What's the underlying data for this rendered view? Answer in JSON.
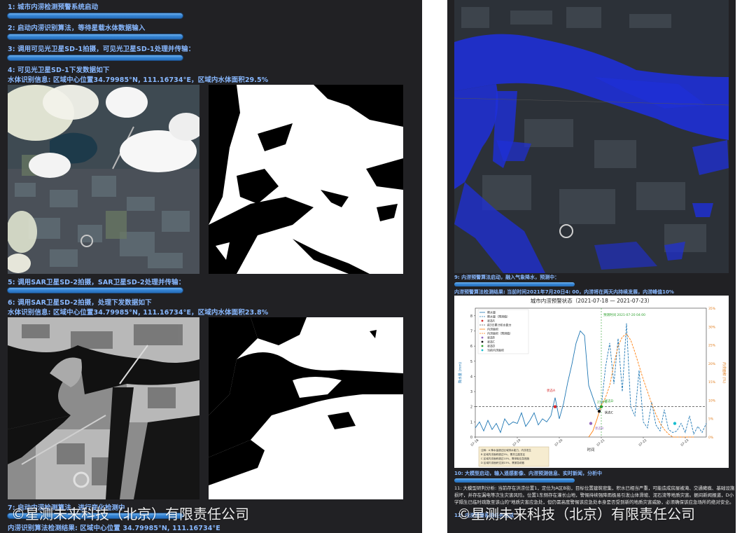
{
  "left": {
    "lines": [
      "1: 城市内涝检测预警系统启动",
      "2: 启动内涝识别算法，等待星载水体数据输入",
      "3: 调用可见光卫星SD-1拍摄，可见光卫星SD-1处理并传输：",
      "4: 可见光卫星SD-1下发数据如下",
      "水体识别信息: 区域中心位置34.79985°N, 111.16734°E，区域内水体面积29.5%",
      "5: 调用SAR卫星SD-2拍摄，SAR卫星SD-2处理并传输：",
      "6: 调用SAR卫星SD-2拍摄，处理下发数据如下",
      "水体识别信息: 区域中心位置34.79985°N, 111.16734°E，区域内水体面积23.8%",
      "7: 启动内涝检测算法，进行变化检测中",
      "内涝识别算法检测结果: 区域中心位置 34.79985°N, 111.16734°E"
    ]
  },
  "right": {
    "lines": [
      "9: 内涝预警算法启动，融入气象降水，预测中：",
      "内涝预警算法检测结果: 当前时间2021年7月20日4: 00，内涝将在两天内持续发展，内涝峰值10%",
      "10: 大模型启动，输入遥感影像、内涝预测信息、实时新闻，分析中",
      "11: 大模型研判分析: 当前存在洪涝位置1，定位为A区B街，目标位置建筑密集，积水已相当严重，可能造成房屋被淹、交通瘫痪、基础设施",
      "损坏，并存在漏电等次生灾害风险。位置1东侧存在灌长山地，警惕持续强降雨极易引发山体滑坡、泥石流等地质灾害。据间新闻报道，D小",
      "学隔生已临时疏散至该山的\"地质灾害应急处，但仍需高度警惕该应急处本身是否受到新的地质灾害威胁，必须确保该应急场所的绝对安全。",
      "12: 内涝预警系统任务完成"
    ]
  },
  "watermark": "©星测未来科技（北京）有限责任公司",
  "chart_data": {
    "type": "line",
    "title": "城市内涝预警状态（2021-07-18 — 2021-07-23）",
    "xlabel": "时间",
    "ylabel": "降水量 (mm)",
    "y2label": "内涝面积 (%)",
    "x_ticks": [
      "07-18",
      "07-19",
      "07-20",
      "07-21",
      "07-22",
      "07-23"
    ],
    "y_ticks": [
      0,
      1,
      2,
      3,
      4,
      5,
      6,
      7,
      8
    ],
    "y2_ticks": [
      "0%",
      "5%",
      "10%",
      "15%",
      "20%",
      "25%",
      "30%",
      "35%"
    ],
    "ylim": [
      0,
      8.5
    ],
    "xlim": [
      0,
      5.5
    ],
    "threshold": 2,
    "legend": [
      "降水量",
      "降水量（预测值）",
      "状态A",
      "前3日累计积水能力",
      "内涝面积",
      "内涝面积（预测值）",
      "状态B",
      "状态C",
      "状态D",
      "当前内涝面积"
    ],
    "series": [
      {
        "name": "降水量",
        "color": "#1f77b4",
        "style": "solid",
        "x": [
          0,
          0.1,
          0.2,
          0.3,
          0.4,
          0.5,
          0.6,
          0.7,
          0.8,
          0.9,
          1.0,
          1.1,
          1.2,
          1.3,
          1.4,
          1.5,
          1.6,
          1.7,
          1.8,
          1.9,
          2.0,
          2.1,
          2.2,
          2.3,
          2.4,
          2.5,
          2.6,
          2.7,
          2.8,
          2.9,
          3.0
        ],
        "values": [
          0.6,
          1.0,
          0.4,
          1.1,
          0.5,
          0.9,
          0.3,
          1.2,
          0.8,
          1.0,
          0.9,
          1.6,
          0.7,
          1.1,
          1.6,
          0.8,
          1.2,
          1.0,
          1.4,
          2.6,
          1.2,
          2.2,
          3.6,
          4.8,
          6.2,
          7.0,
          6.7,
          3.4,
          2.6,
          1.8,
          2.0
        ]
      },
      {
        "name": "降水量（预测值）",
        "color": "#1f77b4",
        "style": "dashed",
        "x": [
          3.0,
          3.1,
          3.2,
          3.3,
          3.4,
          3.5,
          3.6,
          3.7,
          3.8,
          3.9,
          4.0,
          4.1,
          4.2,
          4.3,
          4.4,
          4.5,
          4.6,
          4.7,
          4.8,
          4.9,
          5.0,
          5.1,
          5.2,
          5.3,
          5.4,
          5.5
        ],
        "values": [
          2.0,
          4.6,
          6.2,
          3.5,
          6.5,
          3.0,
          7.5,
          2.0,
          1.4,
          4.4,
          1.0,
          0.6,
          2.3,
          0.8,
          0.4,
          1.8,
          0.5,
          0.3,
          0.4,
          0.9,
          0.3,
          1.4,
          0.2,
          0.7,
          0.3,
          0.9
        ]
      },
      {
        "name": "内涝面积",
        "color": "#ff7f0e",
        "style": "solid",
        "x": [
          2.7,
          2.8,
          2.9,
          3.0
        ],
        "values": [
          0,
          0.4,
          1.2,
          2.1
        ]
      },
      {
        "name": "内涝面积（预测值）",
        "color": "#ff7f0e",
        "style": "dashed",
        "x": [
          3.0,
          3.1,
          3.2,
          3.3,
          3.4,
          3.5,
          3.6,
          3.7,
          3.8,
          3.9,
          4.0,
          4.1,
          4.2,
          4.3,
          4.4,
          4.5,
          4.6,
          4.7,
          4.8,
          4.9,
          5.0,
          5.1,
          5.2
        ],
        "values": [
          2.1,
          2.6,
          3.4,
          4.8,
          6.0,
          6.6,
          6.8,
          6.4,
          5.6,
          4.7,
          3.8,
          3.0,
          2.2,
          1.5,
          0.9,
          0.5,
          0.2,
          0.0,
          0.0,
          0.0,
          0.0,
          0.0,
          0.0
        ]
      }
    ],
    "markers": [
      {
        "label": "状态A",
        "x": 1.9,
        "y": 2.0,
        "color": "#d62728"
      },
      {
        "label": "状态B",
        "x": 2.75,
        "y": 0.9,
        "color": "#9467bd"
      },
      {
        "label": "状态C",
        "x": 2.95,
        "y": 1.7,
        "color": "#111111"
      },
      {
        "label": "状态D",
        "x": 3.0,
        "y": 2.0,
        "color": "#2ca02c"
      },
      {
        "label": "当前内涝面积",
        "x": 4.75,
        "y": 0.9,
        "color": "#17becf"
      }
    ],
    "annotations": [
      "状态A",
      "状态B",
      "状态C",
      "状态D",
      "21.6%",
      "预测时间 2021-07-20 04:00"
    ],
    "note": "注释：A 降水量超过区域排水能力，内涝发生；B 区域内涝面积超过5%，需关注高发区；C 区域内涝面积超过10%，需采取应急措施；D 区域内涝面积达到15%，需紧急疏散"
  }
}
